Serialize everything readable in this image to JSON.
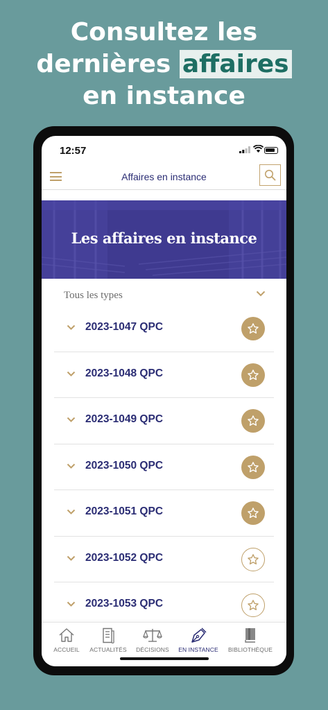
{
  "promo": {
    "line1": "Consultez les",
    "line2_pre": "dernières ",
    "line2_highlight": "affaires",
    "line3": "en instance"
  },
  "status_bar": {
    "time": "12:57"
  },
  "app_bar": {
    "title": "Affaires en instance",
    "menu_icon": "hamburger-icon",
    "search_icon": "search-icon"
  },
  "banner": {
    "title": "Les affaires en instance"
  },
  "filter": {
    "label": "Tous les types"
  },
  "cases": [
    {
      "label": "2023-1047 QPC",
      "favorite": true
    },
    {
      "label": "2023-1048 QPC",
      "favorite": true
    },
    {
      "label": "2023-1049 QPC",
      "favorite": true
    },
    {
      "label": "2023-1050 QPC",
      "favorite": true
    },
    {
      "label": "2023-1051 QPC",
      "favorite": true
    },
    {
      "label": "2023-1052 QPC",
      "favorite": false
    },
    {
      "label": "2023-1053 QPC",
      "favorite": false
    }
  ],
  "tabs": [
    {
      "label": "ACCUEIL",
      "icon": "home-icon",
      "active": false
    },
    {
      "label": "ACTUALITÉS",
      "icon": "document-icon",
      "active": false
    },
    {
      "label": "DÉCISIONS",
      "icon": "scales-icon",
      "active": false
    },
    {
      "label": "EN INSTANCE",
      "icon": "pen-nib-icon",
      "active": true
    },
    {
      "label": "BIBLIOTHÈQUE",
      "icon": "book-icon",
      "active": false
    }
  ],
  "colors": {
    "background": "#699B9C",
    "navy": "#2B2D74",
    "gold": "#BFA06A",
    "banner": "#3F3A90",
    "highlight_text": "#1E6E63"
  }
}
